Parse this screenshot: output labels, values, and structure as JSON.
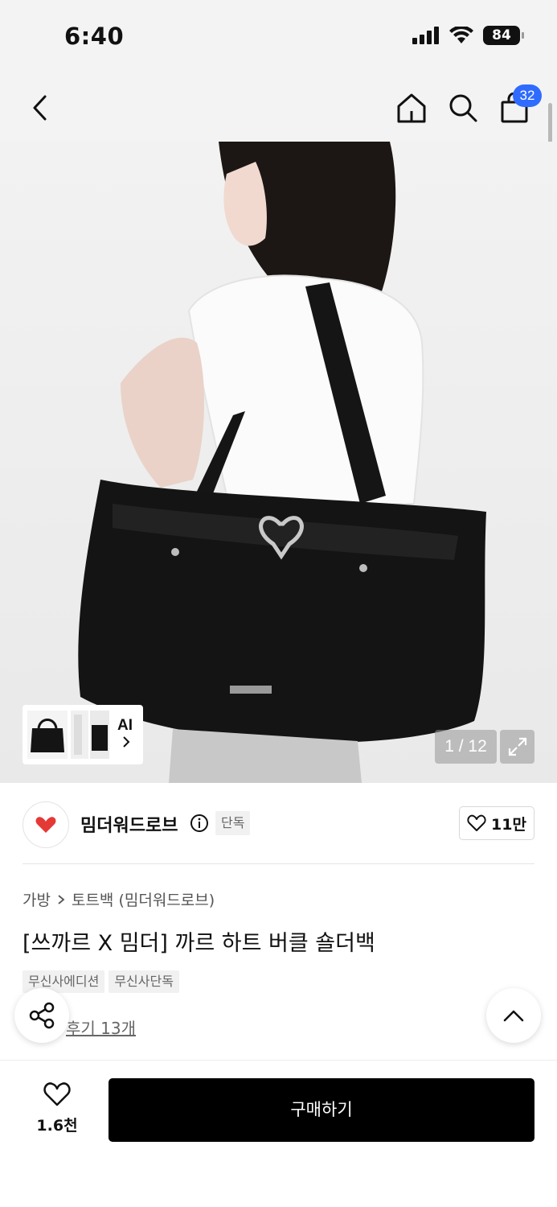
{
  "status_bar": {
    "time": "6:40",
    "battery": "84"
  },
  "nav": {
    "cart_count": "32"
  },
  "gallery": {
    "ai_label": "AI",
    "counter": "1 / 12"
  },
  "brand": {
    "name": "밈더워드로브",
    "exclusive_tag": "단독",
    "likes": "11만"
  },
  "product": {
    "breadcrumb": [
      "가방",
      "토트백 (밈더워드로브)"
    ],
    "title": "[쓰까르 X 밈더] 까르 하트 버클 숄더백",
    "tags": [
      "무신사에디션",
      "무신사단독"
    ],
    "review": "후기 13개"
  },
  "bottom": {
    "wish_count": "1.6천",
    "buy_label": "구매하기"
  },
  "colors": {
    "accent": "#2f6bff",
    "buy_button": "#000000",
    "brand_red": "#e53935"
  }
}
